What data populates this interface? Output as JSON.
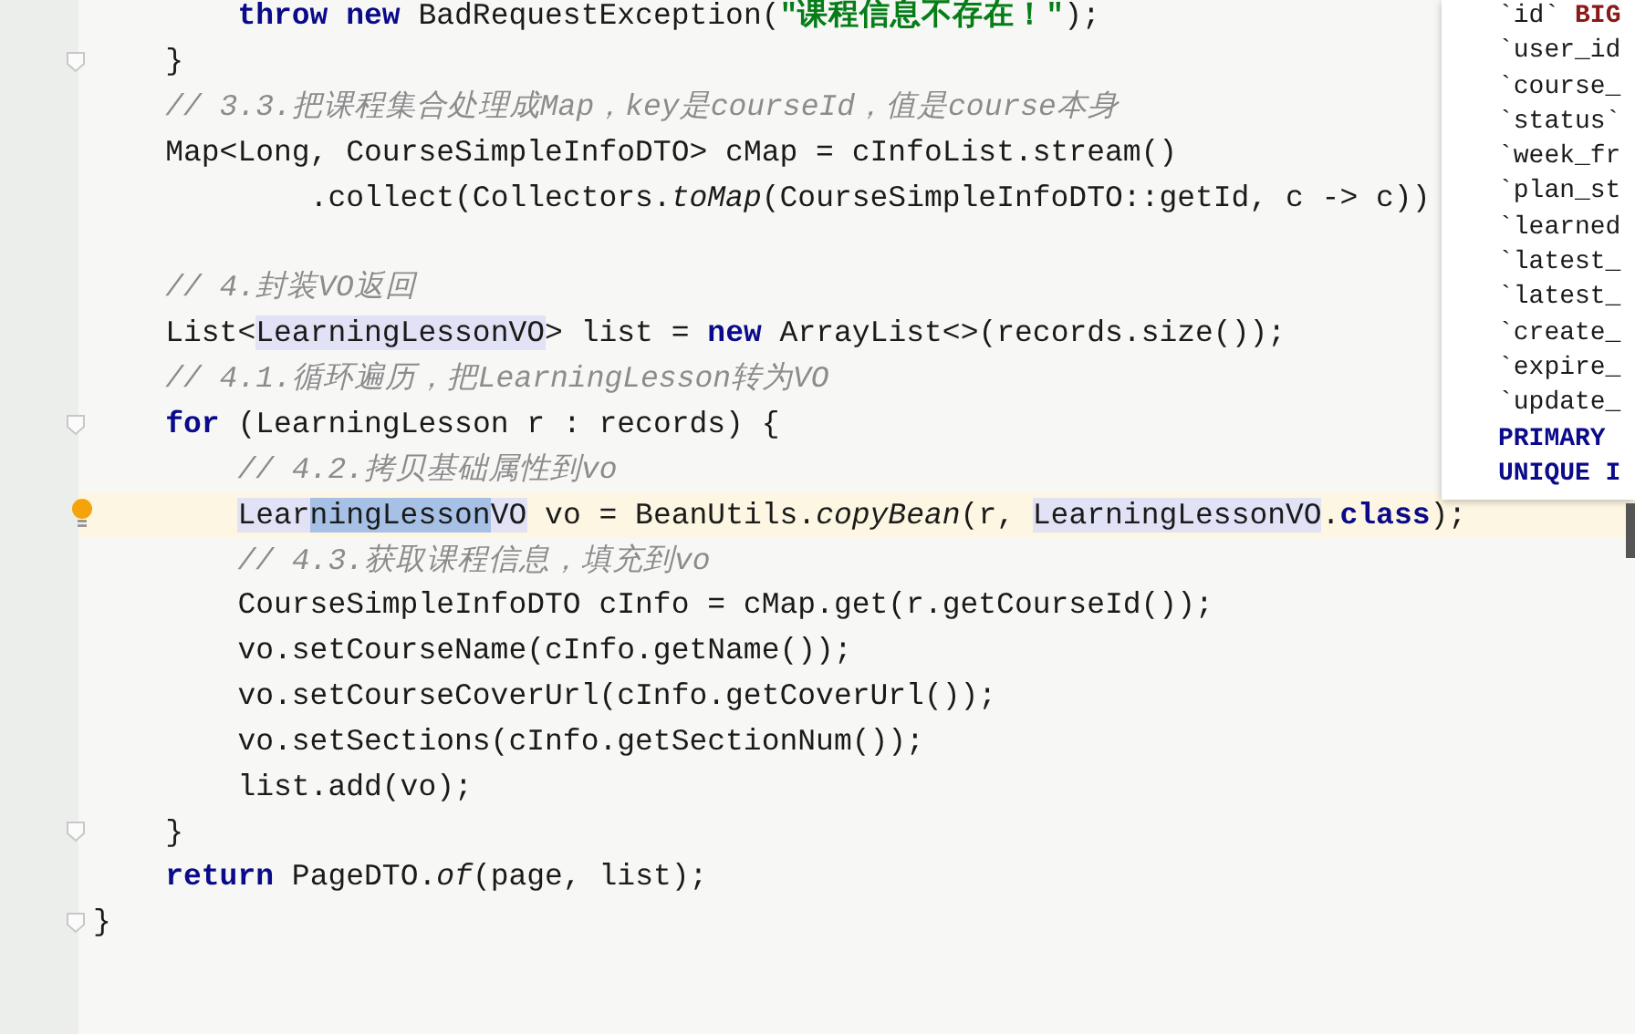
{
  "editor": {
    "lines": [
      {
        "tokens": [
          {
            "text": "        throw new",
            "kind": "keyword"
          },
          {
            "text": " BadRequestException(",
            "kind": "plain"
          },
          {
            "text": "\"课程信息不存在！\"",
            "kind": "string"
          },
          {
            "text": ");",
            "kind": "plain"
          }
        ],
        "current": false,
        "fold": false,
        "bulb": false
      },
      {
        "tokens": [
          {
            "text": "    }",
            "kind": "plain"
          }
        ],
        "current": false,
        "fold": true,
        "bulb": false
      },
      {
        "tokens": [
          {
            "text": "    // 3.3.把课程集合处理成Map，key是courseId，值是course本身",
            "kind": "comment"
          }
        ],
        "current": false,
        "fold": false,
        "bulb": false
      },
      {
        "tokens": [
          {
            "text": "    Map<Long, CourseSimpleInfoDTO> cMap = cInfoList.stream()",
            "kind": "plain"
          }
        ],
        "current": false,
        "fold": false,
        "bulb": false
      },
      {
        "tokens": [
          {
            "text": "            .collect(Collectors.",
            "kind": "plain"
          },
          {
            "text": "toMap",
            "kind": "static"
          },
          {
            "text": "(CourseSimpleInfoDTO::getId, c -> c))",
            "kind": "plain"
          }
        ],
        "current": false,
        "fold": false,
        "bulb": false
      },
      {
        "current": false,
        "fold": false,
        "bulb": false
      },
      {
        "tokens": [
          {
            "text": "    // 4.封装VO返回",
            "kind": "comment"
          }
        ],
        "current": false,
        "fold": false,
        "bulb": false
      },
      {
        "tokens": [
          {
            "text": "    List<",
            "kind": "plain"
          },
          {
            "text": "LearningLessonVO",
            "kind": "usage"
          },
          {
            "text": "> list = ",
            "kind": "plain"
          },
          {
            "text": "new",
            "kind": "keyword"
          },
          {
            "text": " ArrayList<>(records.size());",
            "kind": "plain"
          }
        ],
        "current": false,
        "fold": false,
        "bulb": false
      },
      {
        "tokens": [
          {
            "text": "    // 4.1.循环遍历，把LearningLesson转为VO",
            "kind": "comment"
          }
        ],
        "current": false,
        "fold": false,
        "bulb": false
      },
      {
        "tokens": [
          {
            "text": "    for",
            "kind": "keyword"
          },
          {
            "text": " (LearningLesson r : records) {",
            "kind": "plain"
          }
        ],
        "current": false,
        "fold": true,
        "bulb": false
      },
      {
        "tokens": [
          {
            "text": "        // 4.2.拷贝基础属性到vo",
            "kind": "comment"
          }
        ],
        "current": false,
        "fold": false,
        "bulb": false
      },
      {
        "tokens": [
          {
            "text": "        Lear",
            "kind": "usage"
          },
          {
            "text": "ningLesson",
            "kind": "selected"
          },
          {
            "text": "VO",
            "kind": "usage"
          },
          {
            "text": " vo = BeanUtils.",
            "kind": "plain"
          },
          {
            "text": "copyBean",
            "kind": "static"
          },
          {
            "text": "(r, ",
            "kind": "plain"
          },
          {
            "text": "LearningLessonVO",
            "kind": "usage"
          },
          {
            "text": ".",
            "kind": "plain"
          },
          {
            "text": "class",
            "kind": "keyword"
          },
          {
            "text": ");",
            "kind": "plain"
          }
        ],
        "current": true,
        "fold": false,
        "bulb": true
      },
      {
        "tokens": [
          {
            "text": "        // 4.3.获取课程信息，填充到vo",
            "kind": "comment"
          }
        ],
        "current": false,
        "fold": false,
        "bulb": false
      },
      {
        "tokens": [
          {
            "text": "        CourseSimpleInfoDTO cInfo = cMap.get(r.getCourseId());",
            "kind": "plain"
          }
        ],
        "current": false,
        "fold": false,
        "bulb": false
      },
      {
        "tokens": [
          {
            "text": "        vo.setCourseName(cInfo.getName());",
            "kind": "plain"
          }
        ],
        "current": false,
        "fold": false,
        "bulb": false
      },
      {
        "tokens": [
          {
            "text": "        vo.setCourseCoverUrl(cInfo.getCoverUrl());",
            "kind": "plain"
          }
        ],
        "current": false,
        "fold": false,
        "bulb": false
      },
      {
        "tokens": [
          {
            "text": "        vo.setSections(cInfo.getSectionNum());",
            "kind": "plain"
          }
        ],
        "current": false,
        "fold": false,
        "bulb": false
      },
      {
        "tokens": [
          {
            "text": "        list.add(vo);",
            "kind": "plain"
          }
        ],
        "current": false,
        "fold": false,
        "bulb": false
      },
      {
        "tokens": [
          {
            "text": "    }",
            "kind": "plain"
          }
        ],
        "current": false,
        "fold": true,
        "bulb": false
      },
      {
        "tokens": [
          {
            "text": "    return",
            "kind": "keyword"
          },
          {
            "text": " PageDTO.",
            "kind": "plain"
          },
          {
            "text": "of",
            "kind": "static"
          },
          {
            "text": "(page, list);",
            "kind": "plain"
          }
        ],
        "current": false,
        "fold": false,
        "bulb": false
      },
      {
        "tokens": [
          {
            "text": "}",
            "kind": "plain"
          }
        ],
        "current": false,
        "fold": true,
        "bulb": false
      }
    ]
  },
  "popup": {
    "lines": [
      {
        "tokens": [
          {
            "text": "`id` ",
            "kind": "plain"
          },
          {
            "text": "BIG",
            "kind": "type"
          }
        ]
      },
      {
        "tokens": [
          {
            "text": "`user_id",
            "kind": "plain"
          }
        ]
      },
      {
        "tokens": [
          {
            "text": "`course_",
            "kind": "plain"
          }
        ]
      },
      {
        "tokens": [
          {
            "text": "`status`",
            "kind": "plain"
          }
        ]
      },
      {
        "tokens": [
          {
            "text": "`week_fr",
            "kind": "plain"
          }
        ]
      },
      {
        "tokens": [
          {
            "text": "`plan_st",
            "kind": "plain"
          }
        ]
      },
      {
        "tokens": [
          {
            "text": "`learned",
            "kind": "plain"
          }
        ]
      },
      {
        "tokens": [
          {
            "text": "`latest_",
            "kind": "plain"
          }
        ]
      },
      {
        "tokens": [
          {
            "text": "`latest_",
            "kind": "plain"
          }
        ]
      },
      {
        "tokens": [
          {
            "text": "`create_",
            "kind": "plain"
          }
        ]
      },
      {
        "tokens": [
          {
            "text": "`expire_",
            "kind": "plain"
          }
        ]
      },
      {
        "tokens": [
          {
            "text": "`update_",
            "kind": "plain"
          }
        ]
      },
      {
        "tokens": [
          {
            "text": "PRIMARY",
            "kind": "keyword"
          }
        ]
      },
      {
        "tokens": [
          {
            "text": "UNIQUE I",
            "kind": "keyword"
          }
        ]
      }
    ]
  }
}
